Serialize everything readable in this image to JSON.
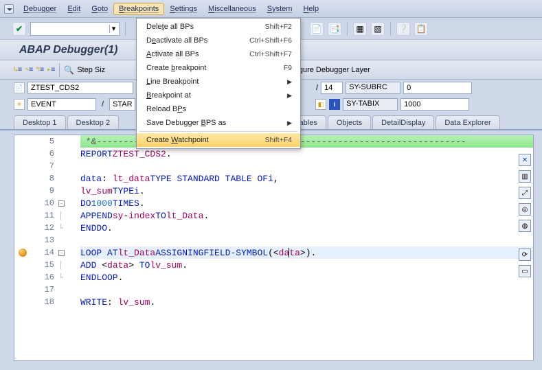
{
  "menubar": {
    "items": [
      "Debugger",
      "Edit",
      "Goto",
      "Breakpoints",
      "Settings",
      "Miscellaneous",
      "System",
      "Help"
    ],
    "active_index": 3
  },
  "breakpoints_menu": {
    "items": [
      {
        "label": "Delete all BPs",
        "shortcut": "Shift+F2",
        "submenu": false
      },
      {
        "label": "Deactivate all BPs",
        "shortcut": "Ctrl+Shift+F6",
        "submenu": false
      },
      {
        "label": "Activate all BPs",
        "shortcut": "Ctrl+Shift+F7",
        "submenu": false
      },
      {
        "label": "Create breakpoint",
        "shortcut": "F9",
        "submenu": false
      },
      {
        "label": "Line Breakpoint",
        "shortcut": "",
        "submenu": true
      },
      {
        "label": "Breakpoint at",
        "shortcut": "",
        "submenu": true
      },
      {
        "label": "Reload BPs",
        "shortcut": "",
        "submenu": false
      },
      {
        "label": "Save Debugger BPS as",
        "shortcut": "",
        "submenu": true
      },
      {
        "label": "Create Watchpoint",
        "shortcut": "Shift+F4",
        "submenu": false
      }
    ],
    "hovered_index": 8
  },
  "title": "ABAP Debugger(1)",
  "subtoolbar": {
    "step_size_label": "Step Siz",
    "config_layer_label": "Configure Debugger Layer"
  },
  "context": {
    "program": "ZTEST_CDS2",
    "event": "EVENT",
    "event_pos": "STAR",
    "line_no": "14",
    "sy_subrc_label": "SY-SUBRC",
    "sy_subrc_value": "0",
    "sy_tabix_label": "SY-TABIX",
    "sy_tabix_value": "1000"
  },
  "tabs": [
    "Desktop 1",
    "Desktop 2",
    "Tables",
    "Objects",
    "DetailDisplay",
    "Data Explorer"
  ],
  "code": {
    "first_line_no": 5,
    "breakpoint_line": 14,
    "current_line": 14,
    "lines": [
      {
        "n": 5,
        "fold": "",
        "type": "comment",
        "text": "*&---------------------------------------------------------------------"
      },
      {
        "n": 6,
        "fold": "",
        "type": "code",
        "html": "<span class='kw'>REPORT</span> <span class='name-red'>ZTEST_CDS2</span>."
      },
      {
        "n": 7,
        "fold": "",
        "type": "code",
        "html": ""
      },
      {
        "n": 8,
        "fold": "",
        "type": "code",
        "html": "<span class='kw'>data</span>: <span class='name-red'>lt_data</span> <span class='kw'>TYPE STANDARD TABLE OF</span> <span class='kw'>i</span>,"
      },
      {
        "n": 9,
        "fold": "",
        "type": "code",
        "html": "      <span class='name-red'>lv_sum</span> <span class='kw'>TYPE</span> <span class='kw'>i</span>."
      },
      {
        "n": 10,
        "fold": "box",
        "type": "code",
        "html": "<span class='kw'>DO</span> <span class='num'>1000</span> <span class='kw'>TIMES</span>."
      },
      {
        "n": 11,
        "fold": "bar",
        "type": "code",
        "html": "  <span class='kw'>APPEND</span> <span class='name-red'>sy</span>-<span class='name-red'>index</span> <span class='kw'>TO</span> <span class='name-red'>lt_Data</span>."
      },
      {
        "n": 12,
        "fold": "end",
        "type": "code",
        "html": "<span class='kw'>ENDDO</span>."
      },
      {
        "n": 13,
        "fold": "",
        "type": "code",
        "html": ""
      },
      {
        "n": 14,
        "fold": "box",
        "type": "code",
        "html": "<span class='kw'>LOOP AT</span> <span class='name-red'>lt_Data</span> <span class='kw'>ASSIGNING</span> <span class='kw'>FIELD-SYMBOL</span>(&lt;<span class='name-red'>da</span><span class='cursor-caret'></span><span class='name-red'>ta</span>&gt;)."
      },
      {
        "n": 15,
        "fold": "bar",
        "type": "code",
        "html": "  <span class='kw'>ADD</span> &lt;<span class='name-red'>data</span>&gt; <span class='kw'>TO</span> <span class='name-red'>lv_sum</span>."
      },
      {
        "n": 16,
        "fold": "end",
        "type": "code",
        "html": "<span class='kw'>ENDLOOP</span>."
      },
      {
        "n": 17,
        "fold": "",
        "type": "code",
        "html": ""
      },
      {
        "n": 18,
        "fold": "",
        "type": "code",
        "html": "<span class='kw'>WRITE</span>: <span class='name-red'>lv_sum</span>."
      }
    ]
  }
}
